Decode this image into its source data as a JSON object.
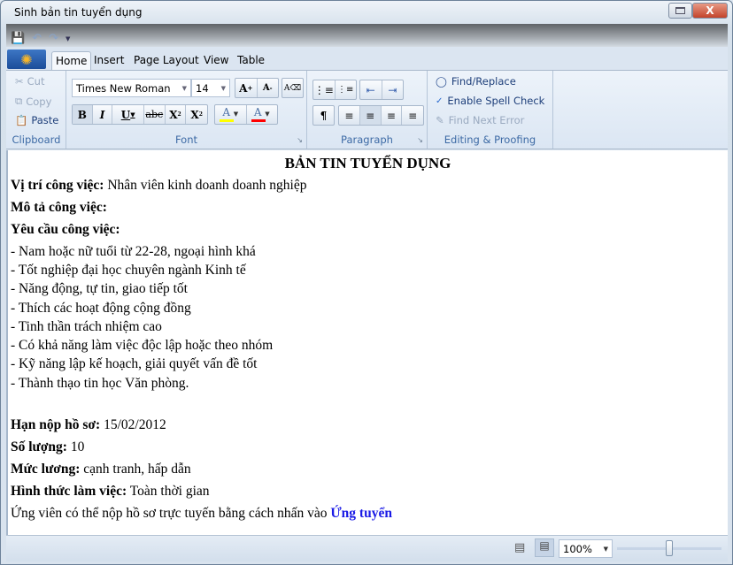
{
  "window": {
    "title": "Sinh bản tin tuyển dụng",
    "close_label": "X"
  },
  "qat": {
    "icons": [
      "save-icon",
      "undo-icon",
      "redo-icon",
      "customize-dropdown-icon"
    ]
  },
  "tabs": [
    {
      "label": "Home",
      "selected": true
    },
    {
      "label": "Insert"
    },
    {
      "label": "Page Layout"
    },
    {
      "label": "View"
    },
    {
      "label": "Table"
    }
  ],
  "clipboard": {
    "label": "Clipboard",
    "cut": "Cut",
    "copy": "Copy",
    "paste": "Paste"
  },
  "font": {
    "label": "Font",
    "family": "Times New Roman",
    "size": "14",
    "highlight_color": "#ffff00",
    "font_color": "#ff0000"
  },
  "paragraph": {
    "label": "Paragraph"
  },
  "editing": {
    "label": "Editing & Proofing",
    "find_replace": "Find/Replace",
    "spell_check": "Enable Spell Check",
    "find_next_error": "Find Next Error"
  },
  "document": {
    "title": "BẢN TIN TUYỂN DỤNG",
    "position_label": "Vị trí công việc:",
    "position_value": "Nhân viên kinh doanh doanh nghiệp",
    "description_label": "Mô tả công việc:",
    "requirements_label": "Yêu cầu công việc:",
    "requirements": [
      "- Nam hoặc nữ tuổi từ 22-28, ngoại hình khá",
      "- Tốt nghiệp đại học chuyên ngành Kinh tế",
      "- Năng động, tự tin, giao tiếp tốt",
      "- Thích các hoạt động cộng đồng",
      "- Tinh thần trách nhiệm cao",
      "- Có khả năng làm việc độc lập hoặc theo nhóm",
      "- Kỹ năng lập kế hoạch, giải quyết vấn đề tốt",
      "- Thành thạo tin học Văn phòng."
    ],
    "deadline_label": "Hạn nộp hồ sơ:",
    "deadline_value": "15/02/2012",
    "quantity_label": "Số lượng:",
    "quantity_value": "10",
    "salary_label": "Mức lương:",
    "salary_value": "cạnh tranh, hấp dẫn",
    "worktype_label": "Hình thức làm việc:",
    "worktype_value": "Toàn thời gian",
    "apply_text": "Ứng viên có thể nộp hồ sơ trực tuyến bằng cách nhấn vào",
    "apply_link": "Ứng tuyển",
    "link_color": "#1a1ae6"
  },
  "status": {
    "zoom": "100%",
    "zoom_slider_percent": 50
  }
}
